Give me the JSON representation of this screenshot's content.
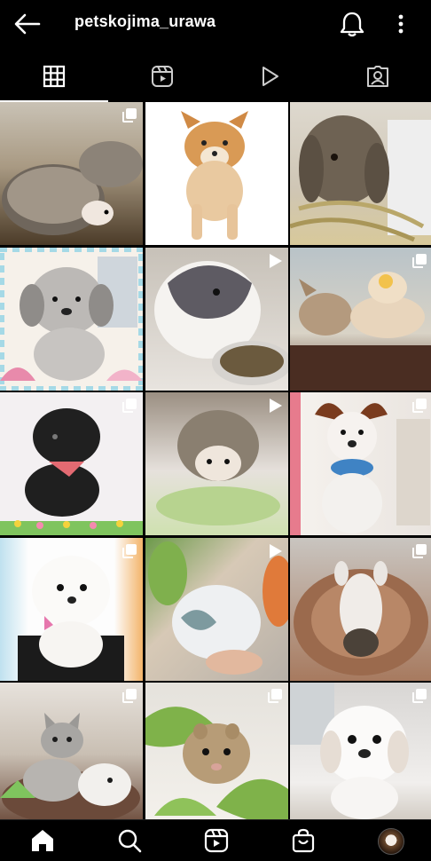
{
  "header": {
    "username": "petskojima_urawa",
    "back_icon": "arrow-left-icon",
    "notifications_icon": "bell-icon",
    "more_icon": "more-vertical-icon"
  },
  "tabs": [
    {
      "icon": "grid-icon",
      "active": true
    },
    {
      "icon": "reels-icon",
      "active": false
    },
    {
      "icon": "play-icon",
      "active": false
    },
    {
      "icon": "tagged-icon",
      "active": false
    }
  ],
  "posts": [
    {
      "subject": "hedgehogs",
      "badge": "multiple"
    },
    {
      "subject": "shiba puppy",
      "badge": "none"
    },
    {
      "subject": "lop rabbit",
      "badge": "none"
    },
    {
      "subject": "grey dog",
      "badge": "none"
    },
    {
      "subject": "rabbit",
      "badge": "video"
    },
    {
      "subject": "chihuahuas",
      "badge": "multiple"
    },
    {
      "subject": "black poodle",
      "badge": "multiple"
    },
    {
      "subject": "hedgehog",
      "badge": "video"
    },
    {
      "subject": "papillon",
      "badge": "multiple"
    },
    {
      "subject": "maltese",
      "badge": "multiple"
    },
    {
      "subject": "budgie",
      "badge": "video"
    },
    {
      "subject": "dog on bed",
      "badge": "multiple"
    },
    {
      "subject": "kittens",
      "badge": "multiple"
    },
    {
      "subject": "hamster",
      "badge": "multiple"
    },
    {
      "subject": "pekingese",
      "badge": "multiple"
    }
  ],
  "bottom_nav": [
    {
      "icon": "home-icon"
    },
    {
      "icon": "search-icon"
    },
    {
      "icon": "reels-icon"
    },
    {
      "icon": "shop-icon"
    },
    {
      "icon": "profile-avatar"
    }
  ],
  "colors": {
    "background": "#000000",
    "text": "#ffffff"
  }
}
